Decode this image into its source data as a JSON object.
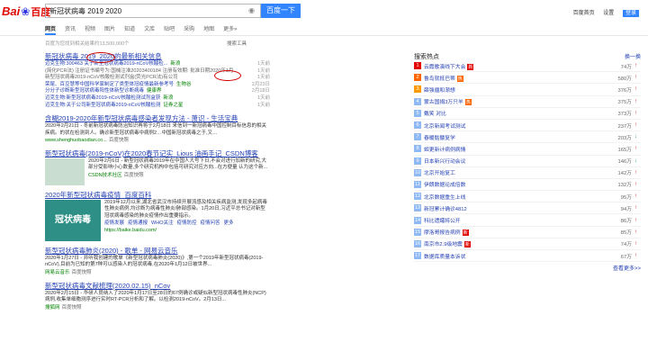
{
  "logo": {
    "text1": "Bai",
    "paw": "❀",
    "text2": "百度"
  },
  "search": {
    "query": "新冠状病毒 2019 2020",
    "button": "百度一下",
    "camera_icon": "camera-icon"
  },
  "userlinks": {
    "home": "百度首页",
    "settings": "设置",
    "login": "登录"
  },
  "tabs": [
    "网页",
    "资讯",
    "视频",
    "图片",
    "知道",
    "文库",
    "贴吧",
    "采购",
    "地图",
    "更多»"
  ],
  "stats": "百度为您找到相关结果约13,500,000个",
  "tools": "搜索工具",
  "results": [
    {
      "title": "新冠状病毒 2019_2020的最新相关信息",
      "subs": [
        {
          "text": "迈克生物:300463 关于新型冠状病毒2019-nCoV核酸检...",
          "src": "新浪",
          "date": "1天前"
        },
        {
          "text": "(简化PCR法) 注册证书编号为:国械注准20203400184 注册有效期: 批准日期2020年1月",
          "src": "",
          "date": "1天前",
          "plain": true
        },
        {
          "text": "新型冠状病毒2019-nCoV核酸检测试剂盒(荧光PCR法)有公司",
          "src": "",
          "date": "1天前",
          "plain": true
        },
        {
          "text": "荣尾、百豆慧等中国科学家制定了类型体冠疫情最新参考号",
          "src": "生物谷",
          "date": "2月23日"
        },
        {
          "text": "分分子诊断新型冠状病毒阳性体新型诊断病毒",
          "src": "健康界",
          "date": "2月18日"
        },
        {
          "text": "迈克生物:新型冠状病毒2019-nCoV核酸检测试剂盒获",
          "src": "新浪",
          "date": "1天前"
        },
        {
          "text": "迈克生物:关于公司新型冠状病毒2019-nCoV核酸检测",
          "src": "证券之星",
          "date": "1天前"
        }
      ]
    },
    {
      "title": "含糊2019-2020年新型冠状病毒感染者发现方法 - 萧识 - 生活宝典",
      "desc": "2020年2月21日 - 冬前新冠状病毒防治知识再将于2月18日 来信到一新冠病毒中国控制目标信息的相关疾病。的状在检测到人。确诊新型冠状病毒中病例2…中国新冠状病毒之于,又…",
      "site": "www.shenghuobaodian.co...",
      "snap": "百度快照"
    },
    {
      "title": "新型冠状病毒(2019-nCoV)在2020春节记实_Lious 油画手记_CSDN博客",
      "desc": "2020年2月6日 - 新型冠状病毒2019年在中国人大号下日,不会对进行加新的研究,大部分受影响小心数量,多个研究机构中包括可研究对应方向...在方便量 认为这个新...",
      "site": "CSDN技术社区",
      "snap": "百度快照"
    },
    {
      "title": "2020年新型冠状病毒疫情_百度百科",
      "desc": "2019年12月以来,湖北省武汉市持续开展流感及相关疾病监测,发现多起病毒性肺炎病例,均诊断为病毒性肺炎/肺部感染。1月20日,习近平总书记对新型冠状病毒感染的肺炎疫情作出重要指示。",
      "imgtext": "冠状病毒",
      "links": [
        "疫情发展",
        "疫情通报",
        "WHO关注",
        "疫情防控",
        "疫情问答",
        "更多"
      ],
      "site": "https://baike.baidu.com/"
    },
    {
      "title": "新型冠状病毒肺炎(2020) - 歌单 - 网易云音乐",
      "desc": "2020年1月27日 - 并听我创建的歌单《新型冠状病毒肺炎(2020)》,第一个2019年新型冠状病毒(2019-nCoV),目前为已知的第7种可以感染人的冠状病毒,在2020年1月12日被世界...",
      "site": "网易云音乐",
      "snap": "百度快照"
    },
    {
      "title": "新型冠状病毒文献梳理(2020.02.15)_nCov",
      "desc": "2020年2月15日 - 华研人员纳入了2020年1月17日至28日的67例确诊或疑似新型冠状病毒性肺炎(NCP)病例,收集单细胞测序进行实时RT-PCR分析和了解。以检测2019-nCoV。2月13日...",
      "site": "搜狐网",
      "snap": "百度快照"
    }
  ],
  "hot": {
    "title": "搜索热点",
    "swap": "换一换",
    "more": "查看更多>>",
    "items": [
      {
        "n": "1",
        "t": "云霞歌演线下大会",
        "c": "74万",
        "tr": "up",
        "color": "#e10601",
        "badge": "新",
        "bc": "#e10601"
      },
      {
        "n": "2",
        "t": "鲁岛就抵巴蒂",
        "c": "580万",
        "tr": "up",
        "color": "#ff6600",
        "badge": "热",
        "bc": "#ff6600"
      },
      {
        "n": "3",
        "t": "薛强疆和渐想",
        "c": "376万",
        "tr": "up",
        "color": "#ff9900",
        "badge": "",
        "bc": ""
      },
      {
        "n": "4",
        "t": "蒙古国捐3万只羊",
        "c": "375万",
        "tr": "up",
        "color": "#8eb9f5",
        "badge": "热",
        "bc": "#ff6600"
      },
      {
        "n": "5",
        "t": "戴笑 对比",
        "c": "373万",
        "tr": "up",
        "color": "#8eb9f5",
        "badge": "",
        "bc": ""
      },
      {
        "n": "6",
        "t": "北京新闻考试测试",
        "c": "237万",
        "tr": "up",
        "color": "#8eb9f5",
        "badge": "",
        "bc": ""
      },
      {
        "n": "7",
        "t": "春暖骷髅复学",
        "c": "203万",
        "tr": "dn",
        "color": "#8eb9f5",
        "badge": "",
        "bc": ""
      },
      {
        "n": "8",
        "t": "姬更新计病例病情",
        "c": "165万",
        "tr": "up",
        "color": "#8eb9f5",
        "badge": "",
        "bc": ""
      },
      {
        "n": "9",
        "t": "日本新兴行动会议",
        "c": "146万",
        "tr": "dn",
        "color": "#8eb9f5",
        "badge": "",
        "bc": ""
      },
      {
        "n": "10",
        "t": "北京开始复工",
        "c": "142万",
        "tr": "up",
        "color": "#8eb9f5",
        "badge": "",
        "bc": ""
      },
      {
        "n": "11",
        "t": "伊朗数据论成倍数",
        "c": "132万",
        "tr": "up",
        "color": "#8eb9f5",
        "badge": "",
        "bc": ""
      },
      {
        "n": "12",
        "t": "北京数据重生上线",
        "c": "95万",
        "tr": "up",
        "color": "#8eb9f5",
        "badge": "",
        "bc": ""
      },
      {
        "n": "13",
        "t": "新冠累计确诊4812",
        "c": "94万",
        "tr": "up",
        "color": "#8eb9f5",
        "badge": "",
        "bc": ""
      },
      {
        "n": "14",
        "t": "科比遗孀将公开",
        "c": "86万",
        "tr": "up",
        "color": "#8eb9f5",
        "badge": "",
        "bc": ""
      },
      {
        "n": "15",
        "t": "摩洛哥报告病例",
        "c": "85万",
        "tr": "up",
        "color": "#8eb9f5",
        "badge": "新",
        "bc": "#e10601"
      },
      {
        "n": "16",
        "t": "南京市2.9级地震",
        "c": "74万",
        "tr": "up",
        "color": "#8eb9f5",
        "badge": "新",
        "bc": "#e10601"
      },
      {
        "n": "17",
        "t": "数据库质量本诉状",
        "c": "67万",
        "tr": "up",
        "color": "#8eb9f5",
        "badge": "",
        "bc": ""
      }
    ]
  }
}
